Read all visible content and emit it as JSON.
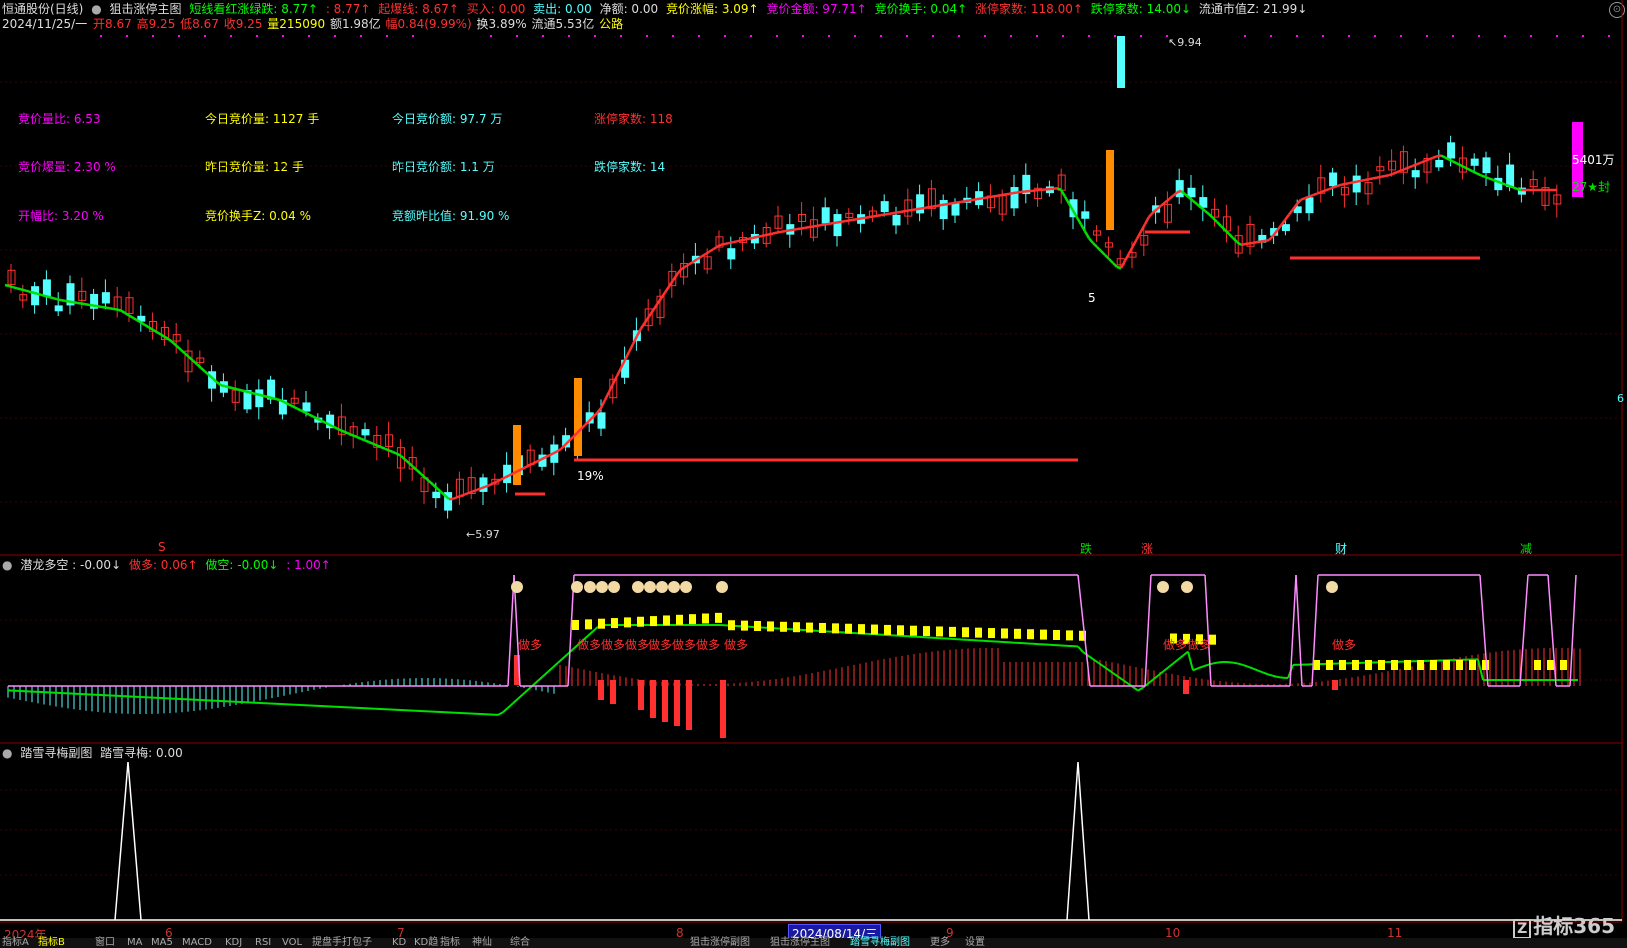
{
  "main_header": {
    "stock_name": "恒通股份(日线)",
    "indicator_name": "狙击涨停主图",
    "short_line_label": "短线看红涨绿跌: 8.77↑",
    "dot_val": ": 8.77↑",
    "bomb_line": "起爆线: 8.67↑",
    "buy_in": "买入: 0.00",
    "sell_out": "卖出: 0.00",
    "net": "净额: 0.00",
    "bid_rise": "竞价涨幅: 3.09↑",
    "bid_amount": "竞价金额: 97.71↑",
    "bid_turnover": "竞价换手: 0.04↑",
    "limit_up_count": "涨停家数: 118.00↑",
    "limit_down_count": "跌停家数: 14.00↓",
    "float_mcap": "流通市值Z: 21.99↓"
  },
  "second_row": {
    "date": "2024/11/25/一",
    "open": "开8.67",
    "high": "高9.25",
    "low": "低8.67",
    "close": "收9.25",
    "vol": "量215090",
    "amount": "额1.98亿",
    "change": "幅0.84(9.99%)",
    "turnover": "换3.89%",
    "float": "流通5.53亿",
    "sector": "公路"
  },
  "stats": {
    "bid_vol_ratio": "竞价量比: 6.53",
    "today_bid_vol": "今日竞价量: 1127  手",
    "today_bid_amt": "今日竞价额: 97.7 万",
    "limit_up": "涨停家数: 118",
    "bid_burst": "竞价爆量: 2.30  %",
    "yest_bid_vol": "昨日竞价量: 12  手",
    "yest_bid_amt": "昨日竞价额: 1.1 万",
    "limit_down": "跌停家数: 14",
    "open_ratio": "开幅比: 3.20 %",
    "bid_turn_z": "竞价换手Z: 0.04  %",
    "bid_yest_ratio": "竞额昨比值: 91.90  %"
  },
  "chart_labels": {
    "high": "9.94",
    "low": "5.97",
    "pct": "19%",
    "right_amount": "5401万",
    "right_seal": "27★封",
    "left_number": "5",
    "edge_six": "6",
    "markers": [
      "跌",
      "涨",
      "财",
      "减"
    ],
    "s_marker": "S"
  },
  "panel2": {
    "name": "潜龙多空",
    "v1": ": -0.00↓",
    "do_long": "做多: 0.06↑",
    "do_short": "做空: -0.00↓",
    "v4": ": 1.00↑",
    "labels": [
      "做多",
      "做多做多做多",
      "做多做多做多",
      "做多",
      "做多做多",
      "做多"
    ]
  },
  "panel3": {
    "name": "踏雪寻梅副图",
    "v": "踏雪寻梅: 0.00"
  },
  "x_axis": {
    "labels": [
      "2024年",
      "6",
      "7",
      "8",
      "9",
      "10",
      "11"
    ],
    "selected": "2024/08/14/三"
  },
  "bottom_tabs": [
    "指标A",
    "指标B",
    "窗口",
    "MA",
    "MA5",
    "MACD",
    "KDJ",
    "RSI",
    "VOL",
    "提盘手打包子",
    "KD",
    "KD趋",
    "指标",
    "神仙",
    "综合",
    "狙击涨停副图",
    "狙击涨停主图",
    "踏雪寻梅副图",
    "更多",
    "设置"
  ],
  "logo": "指标365",
  "colors": {
    "up": "#ff3030",
    "down": "#54ffff",
    "green_line": "#00e000",
    "yellow": "#ffff00",
    "magenta": "#ff00ff",
    "pink_line": "#ff8cff",
    "grid": "#8b0000"
  }
}
